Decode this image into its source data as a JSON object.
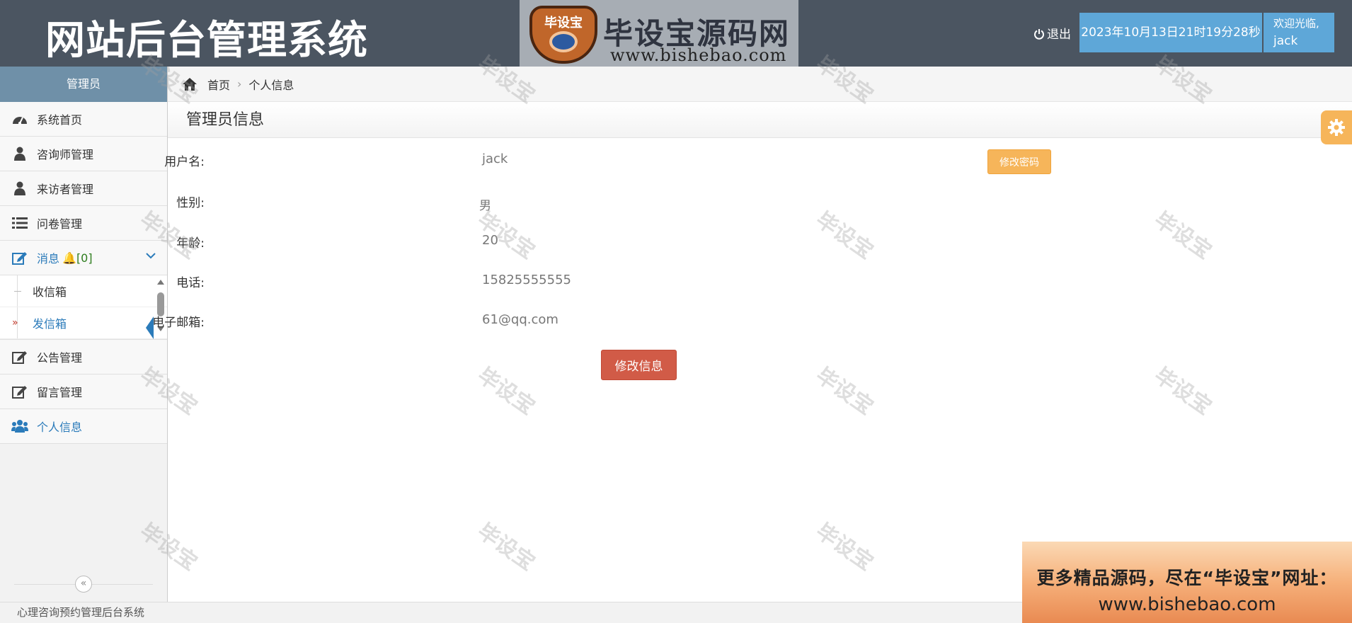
{
  "header": {
    "title": "网站后台管理系统",
    "brand_logo_text": "毕设宝",
    "brand_name": "毕设宝源码网",
    "brand_url": "www.bishebao.com",
    "logout_label": "退出",
    "datetime": "2023年10月13日21时19分28秒",
    "welcome_label": "欢迎光临,",
    "username": "jack"
  },
  "sidebar": {
    "role": "管理员",
    "items": [
      {
        "label": "系统首页",
        "icon": "dashboard-icon"
      },
      {
        "label": "咨询师管理",
        "icon": "user-icon"
      },
      {
        "label": "来访者管理",
        "icon": "user-icon"
      },
      {
        "label": "问卷管理",
        "icon": "list-icon"
      },
      {
        "label": "消息",
        "badge": "🔔[0]",
        "icon": "edit-icon"
      },
      {
        "label": "公告管理",
        "icon": "edit-icon"
      },
      {
        "label": "留言管理",
        "icon": "edit-icon"
      },
      {
        "label": "个人信息",
        "icon": "users-icon"
      }
    ],
    "submenu": [
      "收信箱",
      "发信箱"
    ],
    "submenu_arrow": "»",
    "collapse_icon": "«"
  },
  "breadcrumb": {
    "home": "首页",
    "separator": "›",
    "current": "个人信息"
  },
  "page": {
    "title": "管理员信息",
    "fields": [
      {
        "label": "用户名:",
        "value": "jack"
      },
      {
        "label": "性别:",
        "value": "男"
      },
      {
        "label": "年龄:",
        "value": "20"
      },
      {
        "label": "电话:",
        "value": "15825555555"
      },
      {
        "label": "电子邮箱:",
        "value": "61@qq.com"
      }
    ],
    "change_password_label": "修改密码",
    "save_label": "修改信息"
  },
  "watermark": "毕设宝",
  "footer": {
    "text": "心理咨询预约管理后台系统"
  },
  "promo": {
    "line1": "更多精品源码，尽在“毕设宝”网址：",
    "line2": "www.bishebao.com"
  },
  "colors": {
    "header_bg": "#4b5561",
    "accent_blue": "#5ea7d8",
    "warning_orange": "#f6b55a",
    "danger_red": "#d15b47"
  }
}
